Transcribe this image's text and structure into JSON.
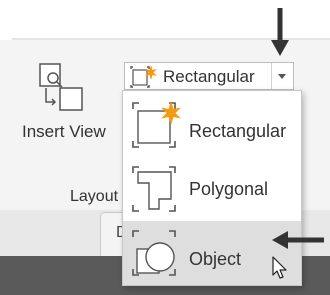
{
  "ribbon": {
    "insert_view_label": "Insert View",
    "panel_label": "Layout",
    "tab_label": "D"
  },
  "dropdown": {
    "selected": "Rectangular",
    "icon": "rectangular-view-icon",
    "arrow_icon": "chevron-down-icon"
  },
  "menu": {
    "items": [
      {
        "label": "Rectangular",
        "icon": "rectangular-view-icon",
        "hover": false
      },
      {
        "label": "Polygonal",
        "icon": "polygonal-view-icon",
        "hover": false
      },
      {
        "label": "Object",
        "icon": "object-view-icon",
        "hover": true
      }
    ]
  },
  "colors": {
    "accent_starburst": "#f39c12",
    "hover_bg": "#dedede",
    "annotation_arrow": "#333333"
  }
}
